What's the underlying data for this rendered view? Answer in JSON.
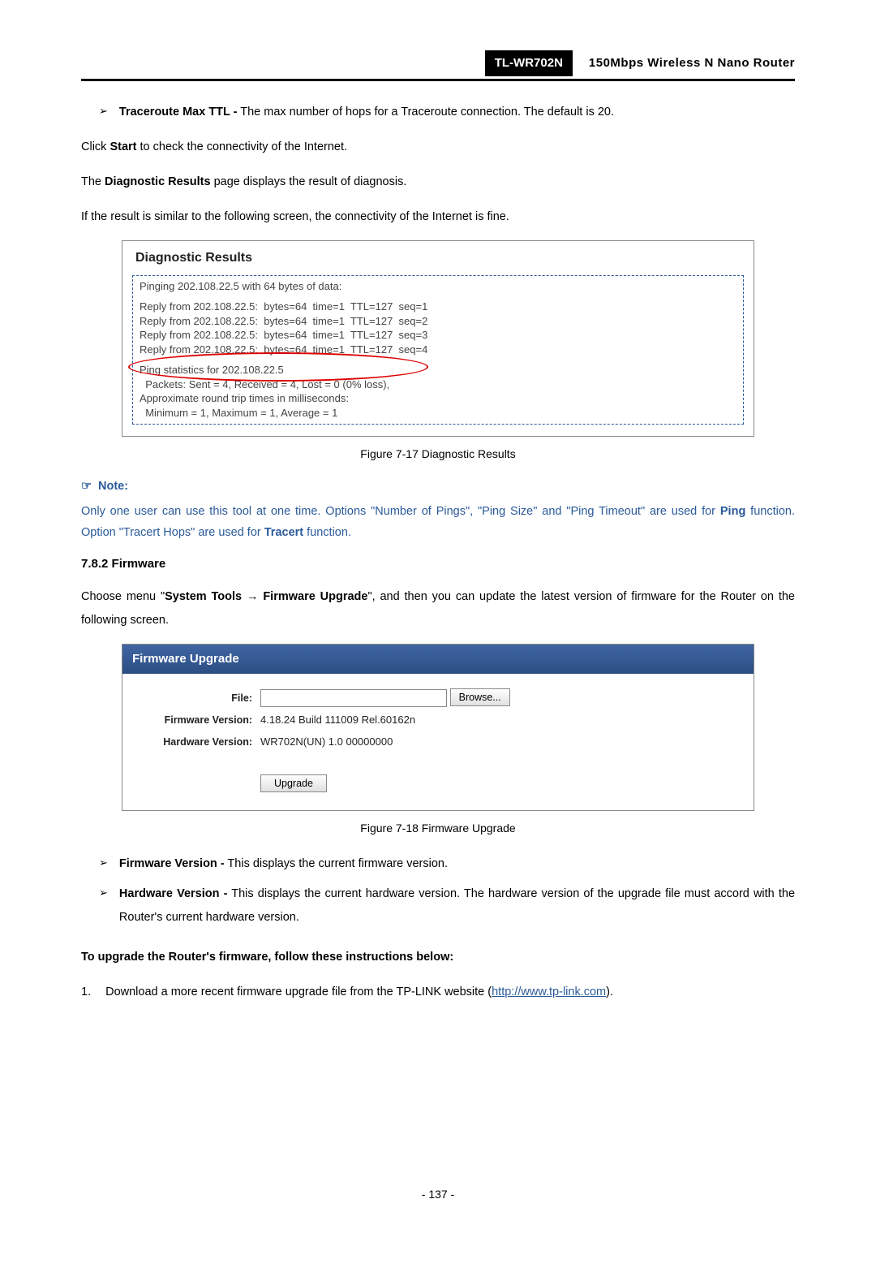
{
  "header": {
    "model": "TL-WR702N",
    "desc": "150Mbps  Wireless  N  Nano  Router"
  },
  "bullet1": {
    "term": "Traceroute Max TTL -",
    "text": " The max number of hops for a Traceroute connection. The default is 20."
  },
  "p1": {
    "a": "Click ",
    "b": "Start",
    "c": " to check the connectivity of the Internet."
  },
  "p2": {
    "a": "The ",
    "b": "Diagnostic Results",
    "c": " page displays the result of diagnosis."
  },
  "p3": "If the result is similar to the following screen, the connectivity of the Internet is fine.",
  "diag": {
    "title": "Diagnostic Results",
    "l1": "Pinging 202.108.22.5 with 64 bytes of data:",
    "r1": "Reply from 202.108.22.5:  bytes=64  time=1  TTL=127  seq=1",
    "r2": "Reply from 202.108.22.5:  bytes=64  time=1  TTL=127  seq=2",
    "r3": "Reply from 202.108.22.5:  bytes=64  time=1  TTL=127  seq=3",
    "r4": "Reply from 202.108.22.5:  bytes=64  time=1  TTL=127  seq=4",
    "s1": "Ping statistics for 202.108.22.5",
    "s2": "  Packets: Sent = 4, Received = 4, Lost = 0 (0% loss),",
    "s3": "Approximate round trip times in milliseconds:",
    "s4": "  Minimum = 1, Maximum = 1, Average = 1"
  },
  "cap1": "Figure 7-17    Diagnostic Results",
  "note": {
    "hdr": "Note:",
    "body_a": "Only one user can use this tool at one time. Options \"Number of Pings\", \"Ping Size\" and \"Ping Timeout\" are used for ",
    "body_b": "Ping",
    "body_c": " function. Option \"Tracert Hops\" are used for ",
    "body_d": "Tracert",
    "body_e": " function."
  },
  "sub": "7.8.2   Firmware",
  "p4": {
    "a": "Choose menu \"",
    "b": "System Tools",
    "c": " → ",
    "d": "Firmware Upgrade",
    "e": "\", and then you can update the latest version of firmware for the Router on the following screen."
  },
  "firm": {
    "title": "Firmware Upgrade",
    "file_lbl": "File:",
    "browse": "Browse...",
    "fv_lbl": "Firmware Version:",
    "fv_val": "4.18.24 Build 111009 Rel.60162n",
    "hv_lbl": "Hardware Version:",
    "hv_val": "WR702N(UN) 1.0 00000000",
    "upgrade": "Upgrade"
  },
  "cap2": "Figure 7-18    Firmware Upgrade",
  "bullet2": {
    "term": "Firmware Version -",
    "text": " This displays the current firmware version."
  },
  "bullet3": {
    "term": "Hardware Version -",
    "text": " This displays the current hardware version. The hardware version of the upgrade file must accord with the Router's current hardware version."
  },
  "p5": "To upgrade the Router's firmware, follow these instructions below:",
  "num1": {
    "n": "1.",
    "a": "Download a more recent firmware upgrade file from the TP-LINK website (",
    "b": "http://www.tp-link.com",
    "c": ")."
  },
  "footer": "- 137 -"
}
